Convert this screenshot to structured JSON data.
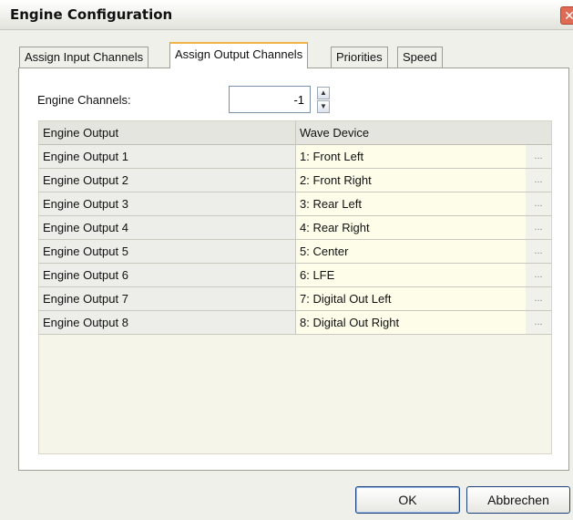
{
  "window": {
    "title": "Engine Configuration",
    "close_glyph": "✕"
  },
  "tabs": [
    {
      "label": "Assign Input Channels"
    },
    {
      "label": "Assign Output Channels",
      "active": true
    },
    {
      "label": "Priorities"
    },
    {
      "label": "Speed"
    }
  ],
  "engine_channels": {
    "label": "Engine Channels:",
    "value": "-1"
  },
  "grid": {
    "columns": [
      "Engine Output",
      "Wave Device"
    ],
    "rows": [
      {
        "output": "Engine Output 1",
        "device": "1: Front Left",
        "button": "..."
      },
      {
        "output": "Engine Output 2",
        "device": "2: Front Right",
        "button": "..."
      },
      {
        "output": "Engine Output 3",
        "device": "3: Rear Left",
        "button": "..."
      },
      {
        "output": "Engine Output 4",
        "device": "4: Rear Right",
        "button": "..."
      },
      {
        "output": "Engine Output 5",
        "device": "5: Center",
        "button": "..."
      },
      {
        "output": "Engine Output 6",
        "device": "6: LFE",
        "button": "..."
      },
      {
        "output": "Engine Output 7",
        "device": "7: Digital Out Left",
        "button": "..."
      },
      {
        "output": "Engine Output 8",
        "device": "8: Digital Out Right",
        "button": "..."
      }
    ]
  },
  "buttons": {
    "ok": "OK",
    "cancel": "Abbrechen"
  },
  "icons": {
    "close": "close-icon",
    "spin_up": "chevron-up-icon",
    "spin_down": "chevron-down-icon"
  },
  "colors": {
    "active_tab_accent": "#f2b447",
    "grid_value_cell": "#fefde9",
    "close_button": "#e06b55"
  }
}
